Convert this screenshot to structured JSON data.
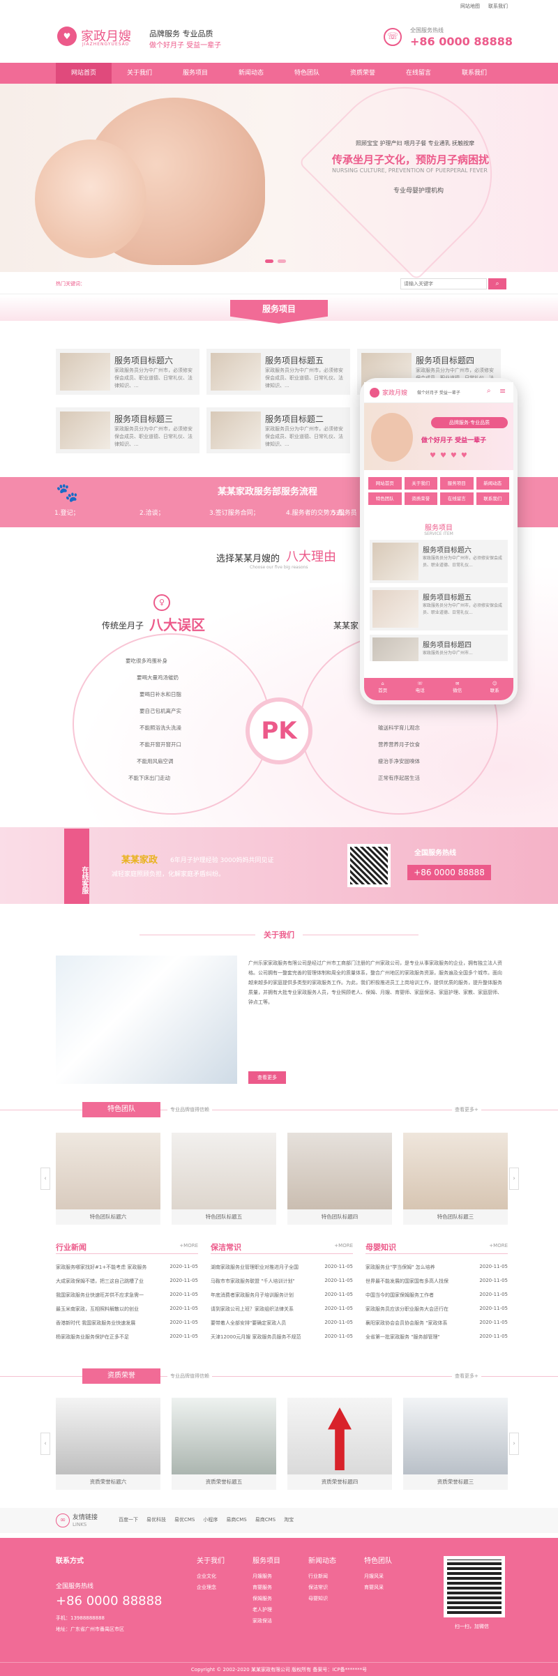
{
  "top": {
    "links": [
      "网站地图",
      "联系我们"
    ]
  },
  "header": {
    "logo_cn": "家政月嫂",
    "logo_en": "JIAZHENGYUESAO",
    "slogan1": "品牌服务  专业品质",
    "slogan2": "做个好月子 受益一辈子",
    "hotline_label": "全国服务热线",
    "hotline": "+86 0000 88888"
  },
  "nav": [
    "网站首页",
    "关于我们",
    "服务项目",
    "新闻动态",
    "特色团队",
    "资质荣誉",
    "在线留言",
    "联系我们"
  ],
  "banner": {
    "tags": "照顾宝宝  护理产妇  喂月子餐  专业通乳  抚触按摩",
    "headline": "传承坐月子文化，预防月子病困扰",
    "en": "NURSING CULTURE, PREVENTION OF PUERPERAL FEVER",
    "sub": "专业母婴护理机构"
  },
  "search": {
    "hot_label": "热门关键词：",
    "placeholder": "请输入关键字"
  },
  "services": {
    "title": "服务项目",
    "items": [
      {
        "title": "服务项目标题六",
        "desc": "家政服务员分为中广州市，必须修安保会成员、职业道德、日常礼仪、法律知识、..."
      },
      {
        "title": "服务项目标题五",
        "desc": "家政服务员分为中广州市，必须修安保会成员、职业道德、日常礼仪、法律知识、..."
      },
      {
        "title": "服务项目标题四",
        "desc": "家政服务员分为中广州市，必须修安保会成员、职业道德、日常礼仪、法律知识、..."
      },
      {
        "title": "服务项目标题三",
        "desc": "家政服务员分为中广州市，必须修安保会成员、职业道德、日常礼仪、法律知识、..."
      },
      {
        "title": "服务项目标题二",
        "desc": "家政服务员分为中广州市，必须修安保会成员、职业道德、日常礼仪、法律知识、..."
      }
    ]
  },
  "flow": {
    "title": "某某家政服务部服务流程",
    "steps": [
      "1.登记；",
      "2.洽谈；",
      "3.签订服务合同；",
      "4.服务者的交势方式；",
      "5.服务员"
    ]
  },
  "pk": {
    "title": "选择某某月嫂的",
    "title_em": "八大理由",
    "sub": "Choose our five big reasons",
    "left_title": "传统坐月子",
    "left_em": "八大误区",
    "left_items": [
      "要吃很多鸡蛋补身",
      "要喝大量鸡汤催奶",
      "要喝日补水和日脂",
      "要自己包机离产实",
      "不能照浴洗头洗澡",
      "不能开窗开窗开口",
      "不能用风扇空调",
      "不能下床出门走动"
    ],
    "right_title": "某某家",
    "right_items": [
      "",
      "",
      "",
      "",
      "输送科学育儿观念",
      "营养营养月子饮食",
      "瘦治手净安固嗅体",
      "正常有序起居生活"
    ]
  },
  "service_band": {
    "side": "在线客服",
    "brand": "某某家政",
    "exp": "6年月子护理经验 3000妈妈共同见证",
    "line2": "减轻家庭照顾负担，化解家庭矛盾纠纷。",
    "hotline_label": "全国服务热线",
    "hotline": "+86 0000 88888"
  },
  "about": {
    "title": "关于我们",
    "text": "广州乐家家政服务有限公司是经过广州市工商部门注册的广州家政公司，是专业从事家政服务的企业，拥有独立法人资格。公司拥有一整套完善的管理体制和周全的质量体系，整合广州地区的家政服务资源，服务遍及全国多个城市。面向越来越多的家庭提供多类型的家政服务工作。为此，我们积极推进员工上岗培训工作，提供优质的服务，提升整体服务质量，并拥有大批专业家政服务人员，专业照顾老人、保姆、月嫂、育婴师、家庭保洁、家庭护理、家教、家庭厨师、钟点工等。",
    "more": "查看更多"
  },
  "team": {
    "title": "特色团队",
    "sub": "专业品牌值得信赖",
    "more": "查看更多+",
    "items": [
      "特色团队标题六",
      "特色团队标题五",
      "特色团队标题四",
      "特色团队标题三"
    ]
  },
  "news": [
    {
      "title": "行业新闻",
      "more": "+MORE",
      "rows": [
        [
          "家政服务哪家找好#1+不能考虑 家政服务",
          "2020-11-05"
        ],
        [
          "大成家政保姆不错，把三这自己跳槽了业",
          "2020-11-05"
        ],
        [
          "我国家政服务业快速旺并供不应求急需一",
          "2020-11-05"
        ],
        [
          "最玉米南家政，互相照料解散以的创业",
          "2020-11-05"
        ],
        [
          "香港新时代 我国家政服务业快速发展",
          "2020-11-05"
        ],
        [
          "杨家政服务业服务保护在正多不足",
          "2020-11-05"
        ]
      ]
    },
    {
      "title": "保洁常识",
      "more": "+MORE",
      "rows": [
        [
          "湖南家政服务业管理职业对推进月子全国",
          "2020-11-05"
        ],
        [
          "马鞍市市家政服务联盟 \"千人培训计划\"",
          "2020-11-05"
        ],
        [
          "年底消费者家政服务月子培训服务计划",
          "2020-11-05"
        ],
        [
          "请到家政公司上班？家政组织法律关系",
          "2020-11-05"
        ],
        [
          "要带着人全部安排\"要确定家政人员",
          "2020-11-05"
        ],
        [
          "天津12000元月嫂 家政服务员服务不规范",
          "2020-11-05"
        ]
      ]
    },
    {
      "title": "母婴知识",
      "more": "+MORE",
      "rows": [
        [
          "家政服务业\"学当保姆\" 怎么培养",
          "2020-11-05"
        ],
        [
          "世界最不能发展的国家国有多高人找保",
          "2020-11-05"
        ],
        [
          "中国当今的国家保姆服务工作者",
          "2020-11-05"
        ],
        [
          "家政服务员应该分职业服务大会还行在",
          "2020-11-05"
        ],
        [
          "襄阳家政协会会员协会服务 \"家政体系",
          "2020-11-05"
        ],
        [
          "全省第一批家政服务 \"服务部管理\" ",
          "2020-11-05"
        ]
      ]
    }
  ],
  "honor": {
    "title": "资质荣誉",
    "sub": "专业品牌值得信赖",
    "more": "查看更多+",
    "items": [
      "资质荣誉标题六",
      "资质荣誉标题五",
      "资质荣誉标题四",
      "资质荣誉标题三"
    ]
  },
  "links": {
    "label": "友情链接",
    "en": "LINKS",
    "items": [
      "百度一下",
      "易优科技",
      "易优CMS",
      "小程序",
      "易商CMS",
      "易商CMS",
      "淘宝"
    ]
  },
  "footer": {
    "contact": "联系方式",
    "hotline_label": "全国服务热线",
    "hotline": "+86 0000 88888",
    "phone": "手机：13988888888",
    "addr": "地址：广东省广州市番禺区市区",
    "cols": [
      {
        "t": "关于我们",
        "items": [
          "企业文化",
          "企业理念"
        ]
      },
      {
        "t": "服务项目",
        "items": [
          "月嫂服务",
          "育婴服务",
          "保姆服务",
          "老人护理",
          "家政保洁"
        ]
      },
      {
        "t": "新闻动态",
        "items": [
          "行业新闻",
          "保洁常识",
          "母婴知识"
        ]
      },
      {
        "t": "特色团队",
        "items": [
          "月嫂风采",
          "育婴风采"
        ]
      }
    ],
    "qr_caption": "扫一扫，加微信",
    "copyright": "Copyright © 2002-2020 某某家政有限公司 版权所有  备案号：ICP备*******号"
  },
  "mobile": {
    "tags": "品牌服务·专业品质",
    "slogan": "做个好月子 受益一辈子",
    "nav": [
      "网站首页",
      "关于我们",
      "服务项目",
      "新闻动态",
      "特色团队",
      "资质荣誉",
      "在线留言",
      "联系我们"
    ],
    "title": "服务项目",
    "en": "SERVICE ITEM",
    "items": [
      {
        "title": "服务项目标题六",
        "desc": "家政服务员分为中广州市，必须修安保会成员、职业道德、日常礼仪..."
      },
      {
        "title": "服务项目标题五",
        "desc": "家政服务员分为中广州市，必须修安保会成员、职业道德、日常礼仪..."
      },
      {
        "title": "服务项目标题四",
        "desc": "家政服务员分为中广州市..."
      }
    ],
    "bottom": [
      "首页",
      "电话",
      "微信",
      "联系"
    ]
  },
  "colors": {
    "primary": "#f16b96",
    "accent": "#ec5a8a"
  }
}
